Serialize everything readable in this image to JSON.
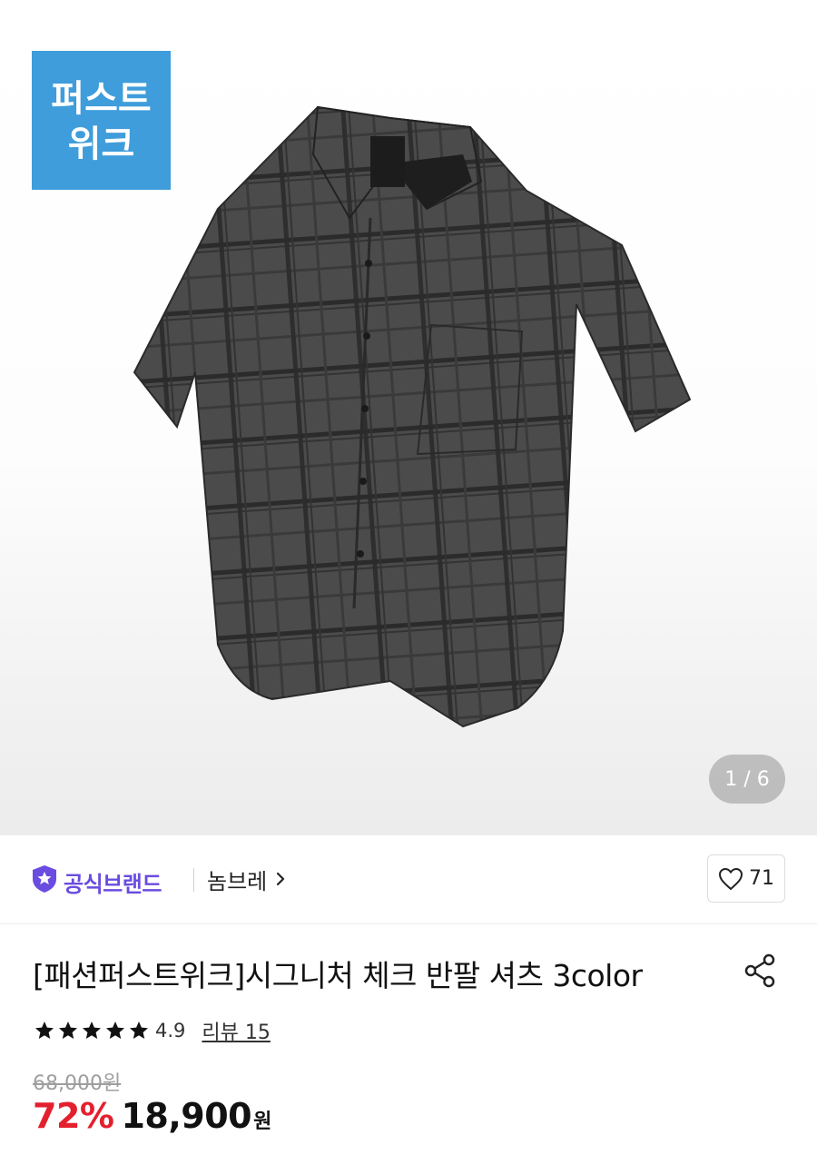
{
  "promo_badge": {
    "text": "퍼스트\n위크",
    "color": "#3f9ddb"
  },
  "gallery": {
    "counter": "1 / 6",
    "product_image": "gray plaid short-sleeve shirt"
  },
  "brand": {
    "official_label": "공식브랜드",
    "official_color": "#6a4ce0",
    "name": "놈브레",
    "official_icon": "shield-star-icon",
    "chevron": "chevron-right-icon"
  },
  "like": {
    "icon": "heart-icon",
    "count": "71"
  },
  "product": {
    "title": "[패션퍼스트위크]시그니처 체크 반팔 셔츠 3color",
    "share_icon": "share-icon"
  },
  "rating": {
    "stars": 5,
    "value": "4.9",
    "review_label": "리뷰 15"
  },
  "price": {
    "original": "68,000원",
    "discount": "72%",
    "sale": "18,900",
    "currency": "원",
    "discount_color": "#e3202e"
  }
}
